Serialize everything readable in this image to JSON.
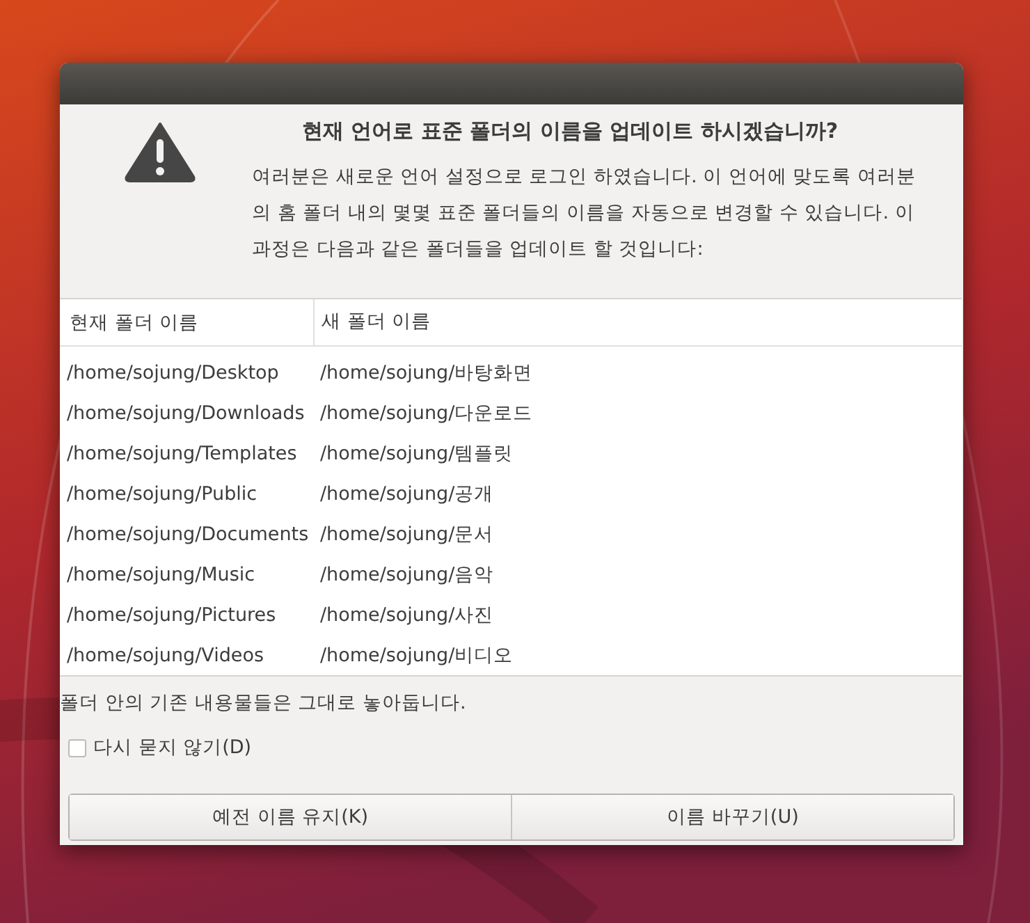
{
  "dialog": {
    "heading": "현재 언어로 표준 폴더의 이름을 업데이트 하시겠습니까?",
    "message": "여러분은 새로운 언어 설정으로 로그인 하였습니다. 이 언어에 맞도록 여러분의 홈 폴더 내의 몇몇 표준 폴더들의 이름을 자동으로 변경할 수 있습니다. 이 과정은 다음과 같은 폴더들을 업데이트 할 것입니다:",
    "table": {
      "columns": [
        "현재 폴더 이름",
        "새 폴더 이름"
      ],
      "rows": [
        [
          "/home/sojung/Desktop",
          "/home/sojung/바탕화면"
        ],
        [
          "/home/sojung/Downloads",
          "/home/sojung/다운로드"
        ],
        [
          "/home/sojung/Templates",
          "/home/sojung/템플릿"
        ],
        [
          "/home/sojung/Public",
          "/home/sojung/공개"
        ],
        [
          "/home/sojung/Documents",
          "/home/sojung/문서"
        ],
        [
          "/home/sojung/Music",
          "/home/sojung/음악"
        ],
        [
          "/home/sojung/Pictures",
          "/home/sojung/사진"
        ],
        [
          "/home/sojung/Videos",
          "/home/sojung/비디오"
        ]
      ]
    },
    "note": "폴더 안의 기존 내용물들은 그대로 놓아둡니다.",
    "checkbox": {
      "label": "다시 묻지 않기(D)",
      "checked": false
    },
    "buttons": [
      "예전 이름 유지(K)",
      "이름 바꾸기(U)"
    ]
  }
}
